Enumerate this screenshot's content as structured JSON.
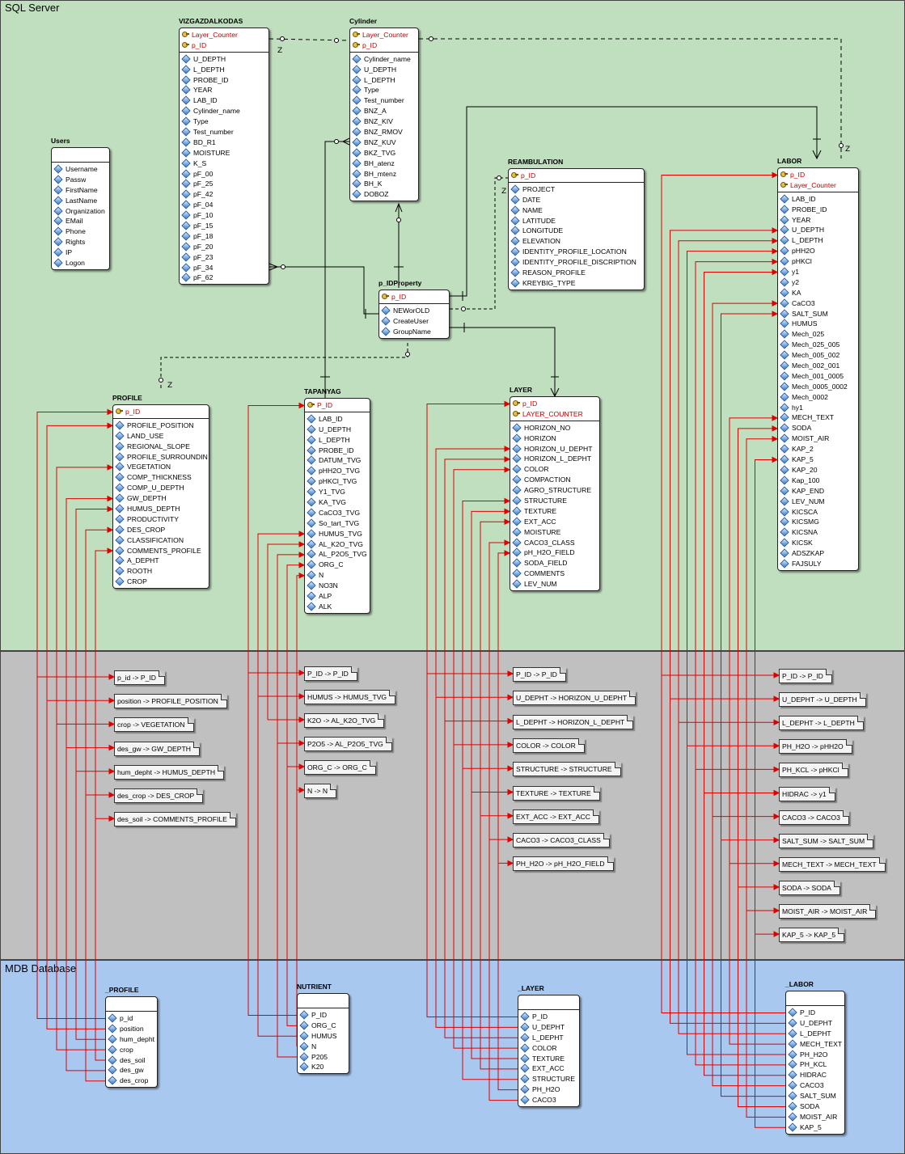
{
  "bands": {
    "sql_server": "SQL Server",
    "mdb": "MDB Database"
  },
  "z_label": "Z",
  "tables": {
    "vizgazdalkodas": {
      "name": "VIZGAZDALKODAS",
      "keys": [
        "Layer_Counter",
        "p_ID"
      ],
      "columns": [
        "U_DEPTH",
        "L_DEPTH",
        "PROBE_ID",
        "YEAR",
        "LAB_ID",
        "Cylinder_name",
        "Type",
        "Test_number",
        "BD_R1",
        "MOISTURE",
        "K_S",
        "pF_00",
        "pF_25",
        "pF_42",
        "pF_04",
        "pF_10",
        "pF_15",
        "pF_18",
        "pF_20",
        "pF_23",
        "pF_34",
        "pF_62"
      ]
    },
    "cylinder": {
      "name": "Cylinder",
      "keys": [
        "Layer_Counter",
        "p_ID"
      ],
      "columns": [
        "Cylinder_name",
        "U_DEPTH",
        "L_DEPTH",
        "Type",
        "Test_number",
        "BNZ_A",
        "BNZ_KIV",
        "BNZ_RMOV",
        "BNZ_KUV",
        "BKZ_TVG",
        "BH_atenz",
        "BH_mtenz",
        "BH_K",
        "DOBOZ"
      ]
    },
    "users": {
      "name": "Users",
      "keys": [],
      "columns": [
        "Username",
        "Passw",
        "FirstName",
        "LastName",
        "Organization",
        "EMail",
        "Phone",
        "Rights",
        "IP",
        "Logon"
      ]
    },
    "reambulation": {
      "name": "REAMBULATION",
      "keys": [
        "p_ID"
      ],
      "columns": [
        "PROJECT",
        "DATE",
        "NAME",
        "LATITUDE",
        "LONGITUDE",
        "ELEVATION",
        "IDENTITY_PROFILE_LOCATION",
        "IDENTITY_PROFILE_DISCRIPTION",
        "REASON_PROFILE",
        "KREYBIG_TYPE"
      ]
    },
    "labor": {
      "name": "LABOR",
      "keys": [
        "p_ID",
        "Layer_Counter"
      ],
      "columns": [
        "LAB_ID",
        "PROBE_ID",
        "YEAR",
        "U_DEPTH",
        "L_DEPTH",
        "pHH2O",
        "pHKCl",
        "y1",
        "y2",
        "KA",
        "CaCO3",
        "SALT_SUM",
        "HUMUS",
        "Mech_025",
        "Mech_025_005",
        "Mech_005_002",
        "Mech_002_001",
        "Mech_001_0005",
        "Mech_0005_0002",
        "Mech_0002",
        "hy1",
        "MECH_TEXT",
        "SODA",
        "MOIST_AIR",
        "KAP_2",
        "KAP_5",
        "KAP_20",
        "Kap_100",
        "KAP_END",
        "LEV_NUM",
        "KICSCA",
        "KICSMG",
        "KICSNA",
        "KICSK",
        "ADSZKAP",
        "FAJSULY"
      ]
    },
    "p_idproperty": {
      "name": "p_IDProperty",
      "keys": [
        "p_ID"
      ],
      "columns": [
        "NEWorOLD",
        "CreateUser",
        "GroupName"
      ]
    },
    "profile": {
      "name": "PROFILE",
      "keys": [
        "p_ID"
      ],
      "columns": [
        "PROFILE_POSITION",
        "LAND_USE",
        "REGIONAL_SLOPE",
        "PROFILE_SURROUNDIN",
        "VEGETATION",
        "COMP_THICKNESS",
        "COMP_U_DEPTH",
        "GW_DEPTH",
        "HUMUS_DEPTH",
        "PRODUCTIVITY",
        "DES_CROP",
        "CLASSIFICATION",
        "COMMENTS_PROFILE",
        "A_DEPHT",
        "ROOTH",
        "CROP"
      ]
    },
    "tapanyag": {
      "name": "TAPANYAG",
      "keys": [
        "P_ID"
      ],
      "columns": [
        "LAB_ID",
        "U_DEPTH",
        "L_DEPTH",
        "PROBE_ID",
        "DATUM_TVG",
        "pHH2O_TVG",
        "pHKCl_TVG",
        "Y1_TVG",
        "KA_TVG",
        "CaCO3_TVG",
        "So_tart_TVG",
        "HUMUS_TVG",
        "AL_K2O_TVG",
        "AL_P2O5_TVG",
        "ORG_C",
        "N",
        "NO3N",
        "ALP",
        "ALK"
      ]
    },
    "layer": {
      "name": "LAYER",
      "keys": [
        "p_ID",
        "LAYER_COUNTER"
      ],
      "columns": [
        "HORIZON_NO",
        "HORIZON",
        "HORIZON_U_DEPHT",
        "HORIZON_L_DEPHT",
        "COLOR",
        "COMPACTION",
        "AGRO_STRUCTURE",
        "STRUCTURE",
        "TEXTURE",
        "EXT_ACC",
        "MOISTURE",
        "CACO3_CLASS",
        "pH_H2O_FIELD",
        "SODA_FIELD",
        "COMMENTS",
        "LEV_NUM"
      ]
    },
    "mdb_profile": {
      "name": "_PROFILE",
      "keys": [],
      "columns": [
        "p_id",
        "position",
        "hum_depht",
        "crop",
        "des_soil",
        "des_gw",
        "des_crop"
      ]
    },
    "mdb_nutrient": {
      "name": "NUTRIENT",
      "keys": [],
      "columns": [
        "P_ID",
        "ORG_C",
        "HUMUS",
        "N",
        "P205",
        "K20"
      ]
    },
    "mdb_layer": {
      "name": "_LAYER",
      "keys": [],
      "columns": [
        "P_ID",
        "U_DEPHT",
        "L_DEPHT",
        "COLOR",
        "TEXTURE",
        "EXT_ACC",
        "STRUCTURE",
        "PH_H2O",
        "CACO3"
      ]
    },
    "mdb_labor": {
      "name": "_LABOR",
      "keys": [],
      "columns": [
        "P_ID",
        "U_DEPHT",
        "L_DEPHT",
        "MECH_TEXT",
        "PH_H2O",
        "PH_KCL",
        "HIDRAC",
        "CACO3",
        "SALT_SUM",
        "SODA",
        "MOIST_AIR",
        "KAP_5"
      ]
    }
  },
  "mappings": {
    "profile": [
      "p_id -> P_ID",
      "position -> PROFILE_POSITION",
      "crop -> VEGETATION",
      "des_gw -> GW_DEPTH",
      "hum_depht -> HUMUS_DEPTH",
      "des_crop -> DES_CROP",
      "des_soil -> COMMENTS_PROFILE"
    ],
    "nutrient": [
      "P_ID -> P_ID",
      "HUMUS -> HUMUS_TVG",
      "K2O -> AL_K2O_TVG",
      "P2O5 -> AL_P2O5_TVG",
      "ORG_C -> ORG_C",
      "N -> N"
    ],
    "layer": [
      "P_ID -> P_ID",
      "U_DEPHT -> HORIZON_U_DEPHT",
      "L_DEPHT -> HORIZON_L_DEPHT",
      "COLOR -> COLOR",
      "STRUCTURE -> STRUCTURE",
      "TEXTURE -> TEXTURE",
      "EXT_ACC -> EXT_ACC",
      "CACO3 -> CACO3_CLASS",
      "PH_H2O -> pH_H2O_FIELD"
    ],
    "labor": [
      "P_ID -> P_ID",
      "U_DEPHT -> U_DEPTH",
      "L_DEPHT -> L_DEPTH",
      "PH_H2O -> pHH2O",
      "PH_KCL -> pHKCl",
      "HIDRAC -> y1",
      "CACO3 -> CACO3",
      "SALT_SUM -> SALT_SUM",
      "MECH_TEXT -> MECH_TEXT",
      "SODA -> SODA",
      "MOIST_AIR -> MOIST_AIR",
      "KAP_5 -> KAP_5"
    ]
  },
  "colors": {
    "sql_band": "#c0dfbf",
    "map_band": "#c0c0c0",
    "mdb_band": "#a8c8f0",
    "mapping_line": "#e00000",
    "key_text": "#c00000"
  }
}
